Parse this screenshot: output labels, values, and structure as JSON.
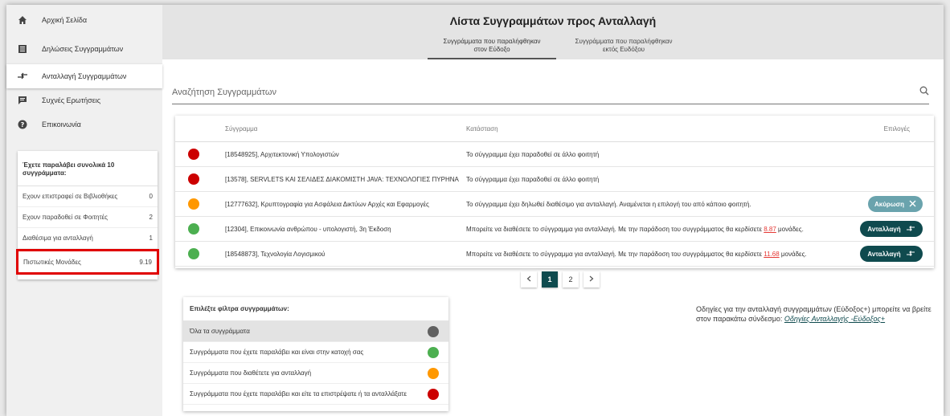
{
  "colors": {
    "red": "#cc0000",
    "orange": "#ff9800",
    "green": "#4caf50",
    "grey": "#616161",
    "teal": "#0f4a4e",
    "teal_light": "#6aa3ad"
  },
  "sidebar": {
    "items": [
      {
        "label": "Αρχική Σελίδα",
        "icon": "home-icon"
      },
      {
        "label": "Δηλώσεις Συγγραμμάτων",
        "icon": "list-icon"
      },
      {
        "label": "Ανταλλαγή Συγγραμμάτων",
        "icon": "exchange-icon"
      },
      {
        "label": "Συχνές Ερωτήσεις",
        "icon": "chat-icon"
      },
      {
        "label": "Επικοινωνία",
        "icon": "help-icon"
      }
    ],
    "stats": {
      "header": "Έχετε παραλάβει συνολικά 10 συγγράμματα:",
      "rows": [
        {
          "label": "Εχουν επιστραφεί σε Βιβλιοθήκες",
          "value": "0"
        },
        {
          "label": "Εχουν παραδοθεί σε Φοιτητές",
          "value": "2"
        },
        {
          "label": "Διαθέσιμα για ανταλλαγή",
          "value": "1"
        },
        {
          "label": "Πιστωτικές Μονάδες",
          "value": "9.19"
        }
      ]
    }
  },
  "header": {
    "title": "Λίστα Συγγραμμάτων προς Ανταλλαγή",
    "tabs": [
      {
        "label1": "Συγγράμματα που παραλήφθηκαν",
        "label2": "στον Εύδοξο"
      },
      {
        "label1": "Συγγράμματα που παραλήφθηκαν",
        "label2": "εκτός Ευδόξου"
      }
    ]
  },
  "search": {
    "placeholder": "Αναζήτηση Συγγραμμάτων"
  },
  "table": {
    "headers": {
      "book": "Σύγγραμμα",
      "status": "Κατάσταση",
      "actions": "Επιλογές"
    },
    "rows": [
      {
        "dot": "red",
        "book": "[18548925], Αρχιτεκτονική Υπολογιστών",
        "status": "Το σύγγραμμα έχει παραδοθεί σε άλλο φοιτητή",
        "action": ""
      },
      {
        "dot": "red",
        "book": "[13578], SERVLETS ΚΑΙ ΣΕΛΙΔΕΣ ΔΙΑΚΟΜΙΣΤΗ JAVA: ΤΕΧΝΟΛΟΓΙΕΣ ΠΥΡΗΝΑ",
        "status": "Το σύγγραμμα έχει παραδοθεί σε άλλο φοιτητή",
        "action": ""
      },
      {
        "dot": "orange",
        "book": "[12777632], Κρυπτογραφία για Ασφάλεια Δικτύων Αρχές και Εφαρμογές",
        "status": "Το σύγγραμμα έχει δηλωθεί διαθέσιμο για ανταλλαγή. Αναμένεται η επιλογή του από κάποιο φοιτητή.",
        "action": "Ακύρωση"
      },
      {
        "dot": "green",
        "book": "[12304], Επικοινωνία ανθρώπου - υπολογιστή, 3η Έκδοση",
        "status_pre": "Μπορείτε να διαθέσετε το σύγγραμμα για ανταλλαγή. Με την παράδοση του συγγράμματος θα κερδίσετε ",
        "status_num": "8.87",
        "status_post": " μονάδες.",
        "action": "Ανταλλαγή"
      },
      {
        "dot": "green",
        "book": "[18548873], Τεχνολογία Λογισμικού",
        "status_pre": "Μπορείτε να διαθέσετε το σύγγραμμα για ανταλλαγή. Με την παράδοση του συγγράμματος θα κερδίσετε ",
        "status_num": "11.68",
        "status_post": " μονάδες.",
        "action": "Ανταλλαγή"
      }
    ]
  },
  "pagination": {
    "pages": [
      "1",
      "2"
    ],
    "current": "1"
  },
  "filters": {
    "header": "Επιλέξτε φίλτρα συγγραμμάτων:",
    "items": [
      {
        "label": "Όλα τα συγγράμματα",
        "dot": "grey"
      },
      {
        "label": "Συγγράμματα που έχετε παραλάβει και είναι στην κατοχή σας",
        "dot": "green"
      },
      {
        "label": "Συγγράμματα που διαθέτετε για ανταλλαγή",
        "dot": "orange"
      },
      {
        "label": "Συγγράμματα που έχετε παραλάβει και είτε τα επιστρέψατε ή τα ανταλλάξατε",
        "dot": "red"
      }
    ]
  },
  "info": {
    "text": "Οδηγίες για την ανταλλαγή συγγραμμάτων (Εύδοξος+) μπορείτε να βρείτε στον παρακάτω σύνδεσμο: ",
    "link": "Οδηγίες Ανταλλαγής -Εύδοξος+"
  }
}
